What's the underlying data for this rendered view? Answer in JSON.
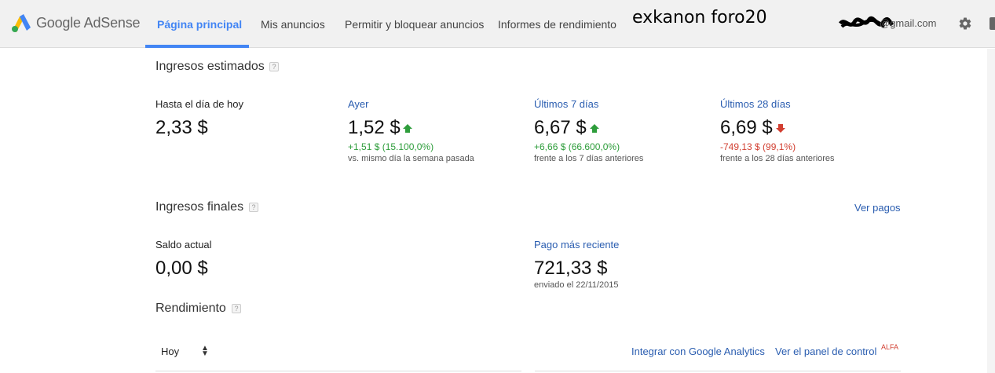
{
  "header": {
    "logo_text": "Google AdSense",
    "nav": [
      {
        "label": "Página principal",
        "active": true
      },
      {
        "label": "Mis anuncios"
      },
      {
        "label": "Permitir y bloquear anuncios"
      },
      {
        "label": "Informes de rendimiento"
      }
    ],
    "overlay_text": "exkanon foro20",
    "email_suffix": "@gmail.com",
    "accent_color": "#4285f4"
  },
  "estimated": {
    "title": "Ingresos estimados",
    "today": {
      "label": "Hasta el día de hoy",
      "value": "2,33 $"
    },
    "yesterday": {
      "label": "Ayer",
      "value": "1,52 $",
      "change": "+1,51 $ (15.100,0%)",
      "compare": "vs. mismo día la semana pasada",
      "trend": "up"
    },
    "last7": {
      "label": "Últimos 7 días",
      "value": "6,67 $",
      "change": "+6,66 $ (66.600,0%)",
      "compare": "frente a los 7 días anteriores",
      "trend": "up"
    },
    "last28": {
      "label": "Últimos 28 días",
      "value": "6,69 $",
      "change": "-749,13 $ (99,1%)",
      "compare": "frente a los 28 días anteriores",
      "trend": "down"
    }
  },
  "final": {
    "title": "Ingresos finales",
    "see_payments": "Ver pagos",
    "balance": {
      "label": "Saldo actual",
      "value": "0,00 $"
    },
    "last_payment": {
      "label": "Pago más reciente",
      "value": "721,33 $",
      "sent": "enviado el 22/11/2015"
    }
  },
  "performance": {
    "title": "Rendimiento",
    "period": "Hoy",
    "integrate_link": "Integrar con Google Analytics",
    "panel_link": "Ver el panel de control",
    "alpha_badge": "ALFA"
  },
  "colors": {
    "up": "#2e9d3b",
    "down": "#d23f31",
    "link": "#2a5db0"
  }
}
